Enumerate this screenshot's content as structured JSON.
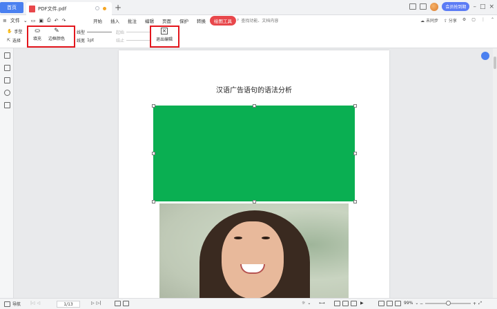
{
  "titlebar": {
    "home_tab": "首页",
    "doc_tab": "PDF文件.pdf",
    "new_tab": "+",
    "member_label": "会员抢到期"
  },
  "menubar": {
    "file_menu": "文件",
    "tabs": [
      "开始",
      "插入",
      "批注",
      "编辑",
      "页面",
      "保护",
      "转换",
      "绘图工具"
    ],
    "active_tab": "绘图工具",
    "search_placeholder": "查找功能、文档内容",
    "sync": "未同步",
    "share": "分享"
  },
  "ribbon": {
    "hand_tool": "手型",
    "select_tool": "选择",
    "fill": "填充",
    "border_color": "边框颜色",
    "line_type": "线型",
    "line_width_label": "线宽",
    "line_width_value": "1pt",
    "start_label": "起始",
    "end_label": "结止",
    "exit_edit": "退出编辑",
    "highlight_color": "#e3151c"
  },
  "document": {
    "title": "汉语广告语句的语法分析",
    "shape_fill_color": "#0aaf52"
  },
  "statusbar": {
    "nav_label": "导航",
    "page_value": "1/13",
    "zoom_value": "99%"
  }
}
